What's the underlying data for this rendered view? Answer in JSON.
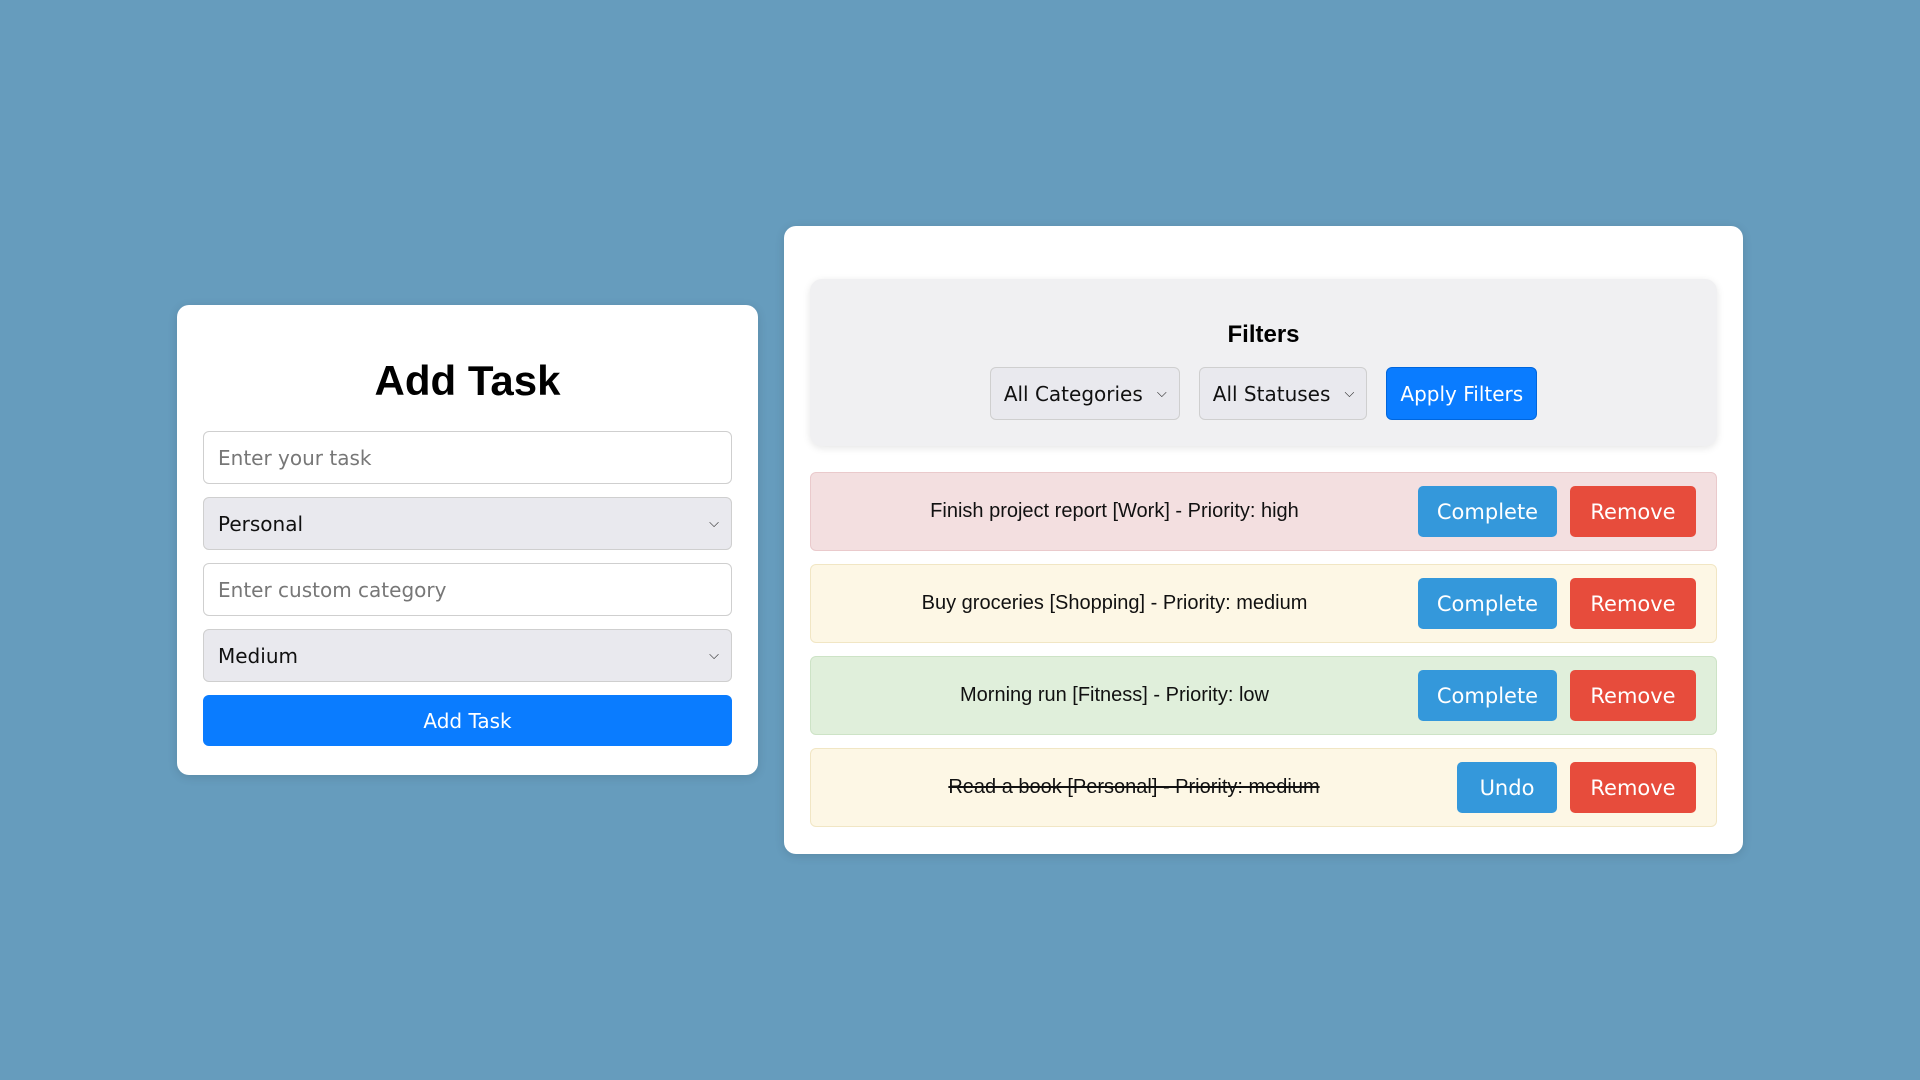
{
  "add_task": {
    "title": "Add Task",
    "task_input_placeholder": "Enter your task",
    "category_selected": "Personal",
    "custom_category_placeholder": "Enter custom category",
    "priority_selected": "Medium",
    "submit_label": "Add Task"
  },
  "filters": {
    "title": "Filters",
    "category_selected": "All Categories",
    "status_selected": "All Statuses",
    "apply_label": "Apply Filters"
  },
  "tasks": [
    {
      "text": "Finish project report [Work] - Priority: high",
      "action_label": "Complete",
      "remove_label": "Remove"
    },
    {
      "text": "Buy groceries [Shopping] - Priority: medium",
      "action_label": "Complete",
      "remove_label": "Remove"
    },
    {
      "text": "Morning run [Fitness] - Priority: low",
      "action_label": "Complete",
      "remove_label": "Remove"
    },
    {
      "text": "Read a book [Personal] - Priority: medium",
      "action_label": "Undo",
      "remove_label": "Remove"
    }
  ],
  "colors": {
    "background": "#669cbd",
    "primary": "#0a7cff",
    "complete": "#3498db",
    "remove": "#e74c3c",
    "priority_high": "#f3dfe0",
    "priority_medium": "#fdf7e5",
    "priority_low": "#e0efdb"
  },
  "icons": {
    "select_arrow": "chevron-down-icon"
  }
}
